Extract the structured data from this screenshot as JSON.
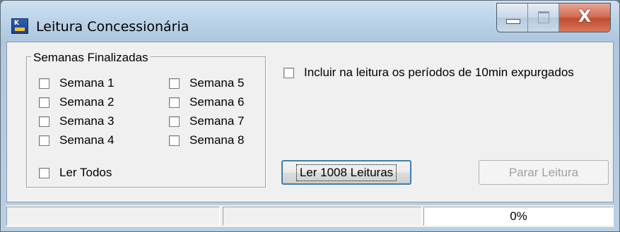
{
  "window": {
    "title": "Leitura Concessionária",
    "icon": "app-logo-icon",
    "icon_letter": "K",
    "caption_buttons": {
      "minimize": "minimize-icon",
      "maximize": "maximize-icon",
      "close_glyph": "X"
    }
  },
  "weeks_group": {
    "label": "Semanas Finalizadas",
    "weeks": [
      "Semana 1",
      "Semana 2",
      "Semana 3",
      "Semana 4",
      "Semana 5",
      "Semana 6",
      "Semana 7",
      "Semana 8"
    ],
    "checked": [
      false,
      false,
      false,
      false,
      false,
      false,
      false,
      false
    ],
    "read_all": {
      "label": "Ler Todos",
      "checked": false
    }
  },
  "include_purged": {
    "label": "Incluir na leitura os períodos de 10min expurgados",
    "checked": false
  },
  "buttons": {
    "read": "Ler 1008 Leituras",
    "stop": "Parar Leitura"
  },
  "status": {
    "panel1": "",
    "panel2": "",
    "progress": "0%"
  },
  "colors": {
    "title_bar": "#bcd3e8",
    "close_button": "#c14d31",
    "primary_button_border": "#3c7fb1"
  }
}
